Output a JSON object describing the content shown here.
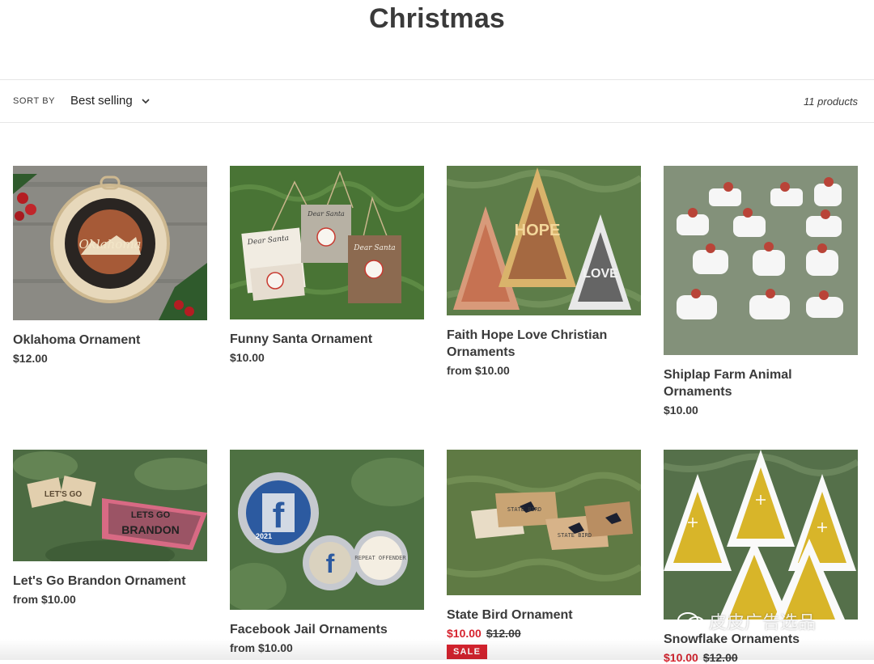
{
  "collection": {
    "title": "Christmas"
  },
  "sort": {
    "label": "SORT BY",
    "selected": "Best selling"
  },
  "product_count": "11 products",
  "products": [
    {
      "name": "Oklahoma Ornament",
      "price": "$12.00"
    },
    {
      "name": "Funny Santa Ornament",
      "price": "$10.00"
    },
    {
      "name": "Faith Hope Love Christian Ornaments",
      "price": "from $10.00"
    },
    {
      "name": "Shiplap Farm Animal Ornaments",
      "price": "$10.00"
    },
    {
      "name": "Let's Go Brandon Ornament",
      "price": "from $10.00"
    },
    {
      "name": "Facebook Jail Ornaments",
      "price": "from $10.00"
    },
    {
      "name": "State Bird Ornament",
      "sale_price": "$10.00",
      "compare_price": "$12.00",
      "badge": "SALE"
    },
    {
      "name": "Snowflake Ornaments",
      "sale_price": "$10.00",
      "compare_price": "$12.00"
    }
  ],
  "image_text": {
    "oklahoma": "Oklahoma",
    "santa_sign": "Dear Santa",
    "hope": "HOPE",
    "love": "LOVE",
    "lets_go": "LET'S GO",
    "brandon_1": "LETS GO",
    "brandon_2": "BRANDON",
    "fb_letter": "f",
    "fb_year": "2021",
    "repeat_offender": "REPEAT OFFENDER",
    "state_bird": "STATE BIRD"
  },
  "watermark": "皮皮广告选品",
  "colors": {
    "sale": "#d6232e",
    "text": "#3a3a3a",
    "fb_blue": "#2c5aa0"
  }
}
